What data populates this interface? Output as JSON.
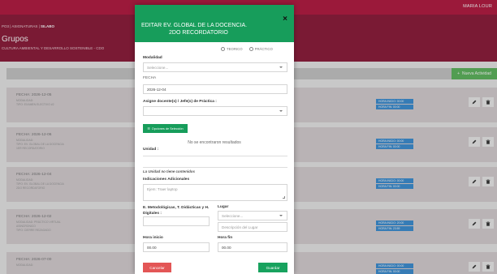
{
  "app": {
    "user": "MARIA LOUR",
    "breadcrumb": {
      "prefix": "PO3 | ASIGNATURAS |",
      "current": "SILABO"
    },
    "page_title": "Grupos",
    "page_subtitle": "CULTURA AMBIENTAL Y DESARROLLO SOSTENIBLE - CDO",
    "new_button_label": "Nueva Actividad"
  },
  "cards": [
    {
      "fecha": "FECHA: 2026-12-05",
      "lines": [
        "MODALIDAD:",
        "TIPO: EXAMEN ELECTIVO #2"
      ],
      "badges": [
        "HORA INICIO: 00:00",
        "HORA FIN: 00:00"
      ]
    },
    {
      "fecha": "FECHA: 2026-12-06",
      "lines": [
        "MODALIDAD:",
        "TIPO: EV. GLOBAL DE LA DOCENCIA",
        "1ER RECORDATORIO"
      ],
      "badges": [
        "HORA INICIO: 00:00",
        "HORA FIN: 00:00"
      ]
    },
    {
      "fecha": "FECHA: 2026-12-04",
      "lines": [
        "MODALIDAD:",
        "TIPO: EV. GLOBAL DE LA DOCENCIA",
        "2DO RECORDATORIO"
      ],
      "badges": [
        "HORA INICIO: 00:00",
        "HORA FIN: 00:00"
      ]
    },
    {
      "fecha": "FECHA: 2026-12-02",
      "lines": [
        "MODALIDAD: PRÁCTICO VIRTUAL",
        "ASINCRONICO",
        "TIPO: CIERRE REZAGADO"
      ],
      "badges": [
        "HORA INICIO: 20:00",
        "HORA FIN: 23:59"
      ]
    },
    {
      "fecha": "FECHA: 2026-07-00",
      "lines": [
        "MODALIDAD:"
      ],
      "badges": [
        "HORA INICIO: 00:00",
        "HORA FIN: 00:00"
      ]
    }
  ],
  "modal": {
    "title_line1": "EDITAR EV. GLOBAL DE LA DOCENCIA.",
    "title_line2": "2DO RECORDATORIO",
    "close": "×",
    "radio_teorico": "TEORICO",
    "radio_practico": "PRÁCTICO",
    "modalidad_label": "Modalidad",
    "modalidad_placeholder": "Seleccione...",
    "fecha_label": "FECHA",
    "fecha_value": "2026-12-04",
    "asigne_label": "Asigne docente(s) / Jefe(s) de Práctica :",
    "opciones_button": "Opciones de Selección",
    "no_results": "No se encontraron resultados",
    "unidad_label": "Unidad :",
    "unidad_note": "La Unidad no tiene contenidos",
    "indicaciones_label": "Indicaciones Adicionales",
    "indicaciones_placeholder": "Ejem: Traer laptop",
    "metodologicas_label": "E. Metodológicas, T. Didácticas y H. Digitales :",
    "lugar_label": "Lugar",
    "lugar_placeholder": "Seleccione...",
    "lugar_desc_placeholder": "Descripción del Lugar",
    "hora_inicio_label": "Hora inicio",
    "hora_inicio_value": "00.00",
    "hora_fin_label": "Hora fin",
    "hora_fin_value": "00.00",
    "cancel_label": "Cancelar",
    "save_label": "Guardar"
  },
  "colors": {
    "topbar": "#b5173f",
    "header": "#8d1838",
    "modal_header": "#179d5b",
    "save": "#18a25e",
    "cancel": "#e35656",
    "badge": "#3a8fd6"
  }
}
